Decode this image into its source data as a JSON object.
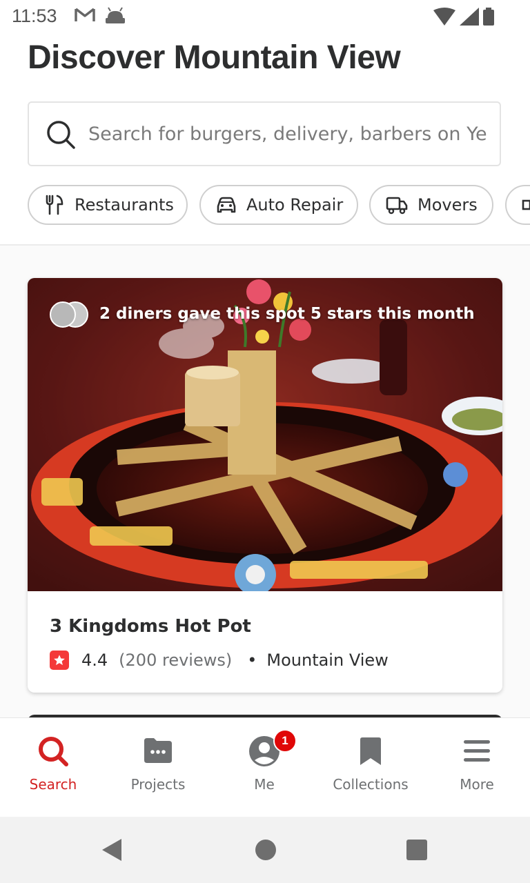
{
  "status_bar": {
    "time": "11:53",
    "left_icons": [
      "gmail-icon",
      "android-icon"
    ],
    "right_icons": [
      "wifi-icon",
      "signal-icon",
      "battery-icon"
    ]
  },
  "header": {
    "title": "Discover Mountain View"
  },
  "search": {
    "placeholder": "Search for burgers, delivery, barbers on Yelp",
    "icon": "search-icon"
  },
  "categories": [
    {
      "label": "Restaurants",
      "icon": "fork-knife-icon"
    },
    {
      "label": "Auto Repair",
      "icon": "car-icon"
    },
    {
      "label": "Movers",
      "icon": "truck-icon"
    },
    {
      "label": "",
      "icon": "more-category-icon"
    }
  ],
  "feed": {
    "card": {
      "banner_text": "2 diners gave this spot 5 stars this month",
      "name": "3 Kingdoms Hot Pot",
      "rating": "4.4",
      "reviews": "(200 reviews)",
      "bullet": "•",
      "locality": "Mountain View"
    }
  },
  "tab_bar": {
    "tabs": [
      {
        "label": "Search",
        "icon": "search-icon",
        "active": true
      },
      {
        "label": "Projects",
        "icon": "projects-icon",
        "active": false
      },
      {
        "label": "Me",
        "icon": "profile-icon",
        "active": false,
        "badge": "1"
      },
      {
        "label": "Collections",
        "icon": "bookmark-icon",
        "active": false
      },
      {
        "label": "More",
        "icon": "menu-icon",
        "active": false
      }
    ]
  },
  "colors": {
    "brand_red": "#d32323",
    "star_red": "#f43939",
    "text_dark": "#2d2e2f",
    "text_muted": "#6e7072"
  }
}
